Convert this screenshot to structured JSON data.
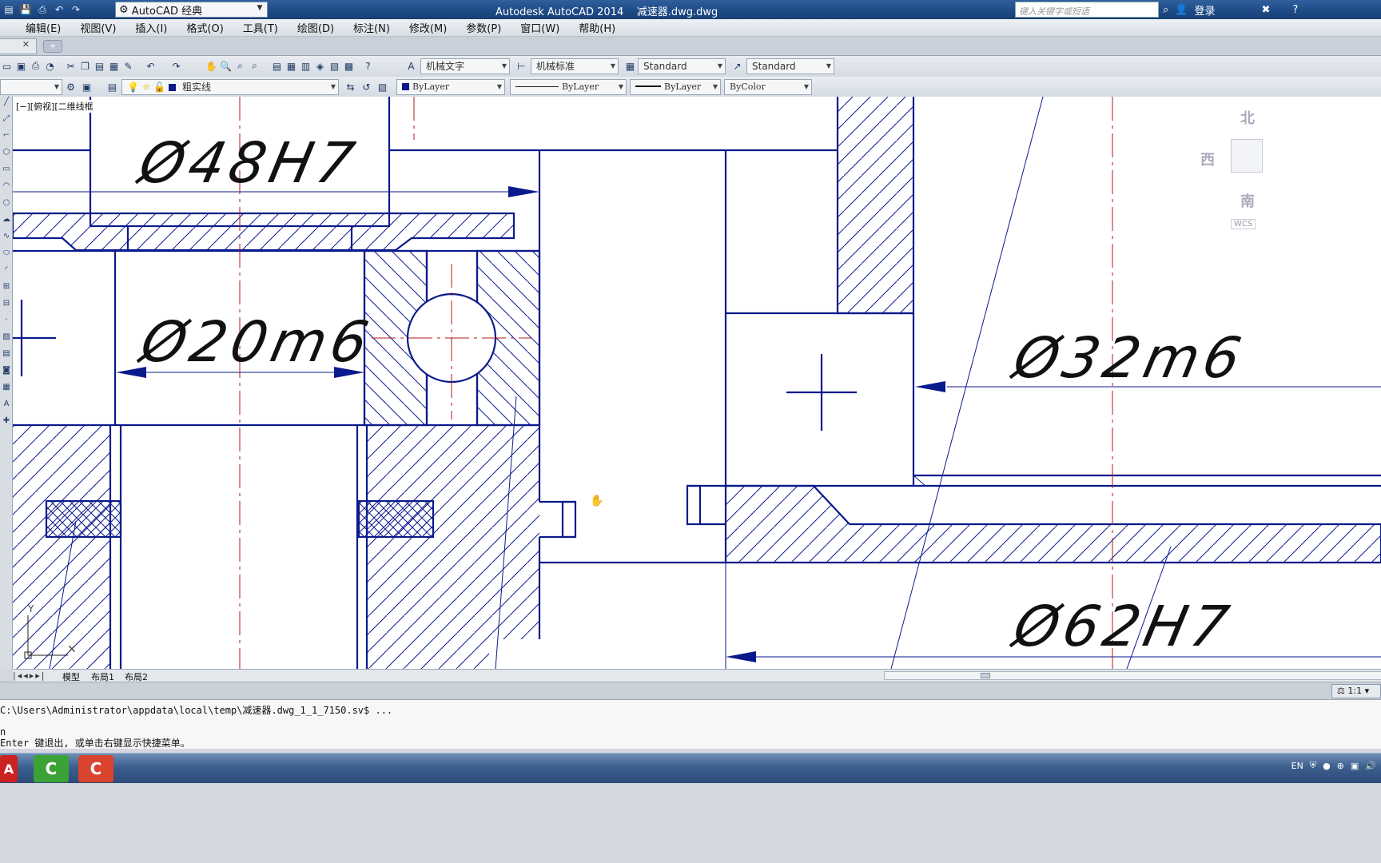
{
  "titlebar": {
    "workspace": "AutoCAD 经典",
    "app_title": "Autodesk AutoCAD 2014    减速器.dwg.dwg",
    "search_placeholder": "键入关键字或短语",
    "login": "登录"
  },
  "menu": [
    "编辑(E)",
    "视图(V)",
    "插入(I)",
    "格式(O)",
    "工具(T)",
    "绘图(D)",
    "标注(N)",
    "修改(M)",
    "参数(P)",
    "窗口(W)",
    "帮助(H)"
  ],
  "styles": {
    "text_style": "机械文字",
    "dim_style": "机械标准",
    "table_style": "Standard",
    "mleader_style": "Standard"
  },
  "layers": {
    "current_layer": "粗实线",
    "color": "ByLayer",
    "linetype": "ByLayer",
    "lineweight": "ByLayer",
    "plotstyle": "ByColor",
    "layer_color_hex": "#0a1a8c"
  },
  "viewport": {
    "label": "[−][俯视][二维线框",
    "dims": [
      "Ø48H7",
      "Ø20m6",
      "Ø32m6",
      "Ø62H7"
    ]
  },
  "viewcube": {
    "north": "北",
    "west": "西",
    "south": "南",
    "wcs": "WCS"
  },
  "layout_tabs": [
    "模型",
    "布局1",
    "布局2"
  ],
  "status": {
    "scale": "1:1"
  },
  "command": {
    "line1": "C:\\Users\\Administrator\\appdata\\local\\temp\\减速器.dwg_1_1_7150.sv$ ...",
    "line2": "n",
    "line3": "Enter 键退出, 或单击右键显示快捷菜单。"
  },
  "tray": {
    "lang": "EN"
  },
  "colors": {
    "drawing_line": "#0a1a8c",
    "centerline": "#b01818",
    "background": "#ffffff"
  }
}
